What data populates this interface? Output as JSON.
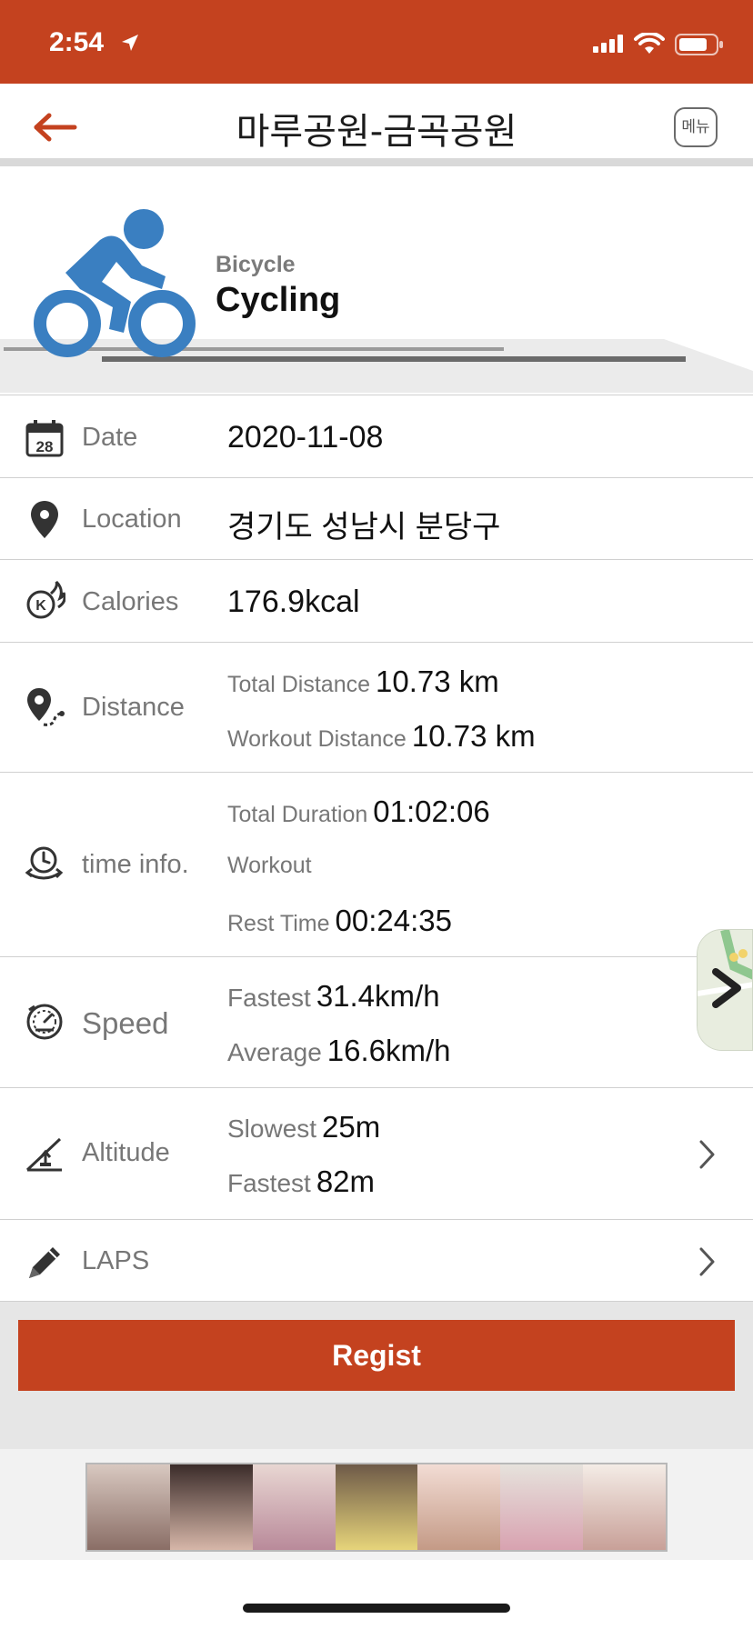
{
  "status_bar": {
    "time": "2:54",
    "background": "#c4421f"
  },
  "nav": {
    "title": "마루공원-금곡공원",
    "menu_label": "메뉴",
    "back_icon": "arrow-left-icon"
  },
  "activity": {
    "subtitle": "Bicycle",
    "name": "Cycling",
    "icon": "cyclist-icon",
    "icon_color": "#3a7fc1"
  },
  "rows": {
    "date": {
      "label": "Date",
      "value": "2020-11-08",
      "icon": "calendar-icon"
    },
    "location": {
      "label": "Location",
      "value": "경기도 성남시 분당구",
      "icon": "map-pin-icon"
    },
    "calories": {
      "label": "Calories",
      "value": "176.9kcal",
      "icon": "calories-flame-icon"
    },
    "distance": {
      "label": "Distance",
      "icon": "route-pin-icon",
      "total_label": "Total Distance",
      "total_value": "10.73 km",
      "workout_label": "Workout Distance",
      "workout_value": "10.73 km"
    },
    "time": {
      "label": "time info.",
      "icon": "clock-refresh-icon",
      "total_label": "Total Duration",
      "total_value": "01:02:06",
      "workout_label": "Workout",
      "rest_label": "Rest Time",
      "rest_value": "00:24:35"
    },
    "speed": {
      "label": "Speed",
      "icon": "speedometer-icon",
      "fastest_label": "Fastest",
      "fastest_value": "31.4km/h",
      "average_label": "Average",
      "average_value": "16.6km/h"
    },
    "altitude": {
      "label": "Altitude",
      "icon": "altitude-slope-icon",
      "slowest_label": "Slowest",
      "slowest_value": "25m",
      "fastest_label": "Fastest",
      "fastest_value": "82m"
    },
    "laps": {
      "label": "LAPS",
      "icon": "pencil-icon"
    }
  },
  "regist_button": {
    "label": "Regist",
    "color": "#c4421f"
  }
}
